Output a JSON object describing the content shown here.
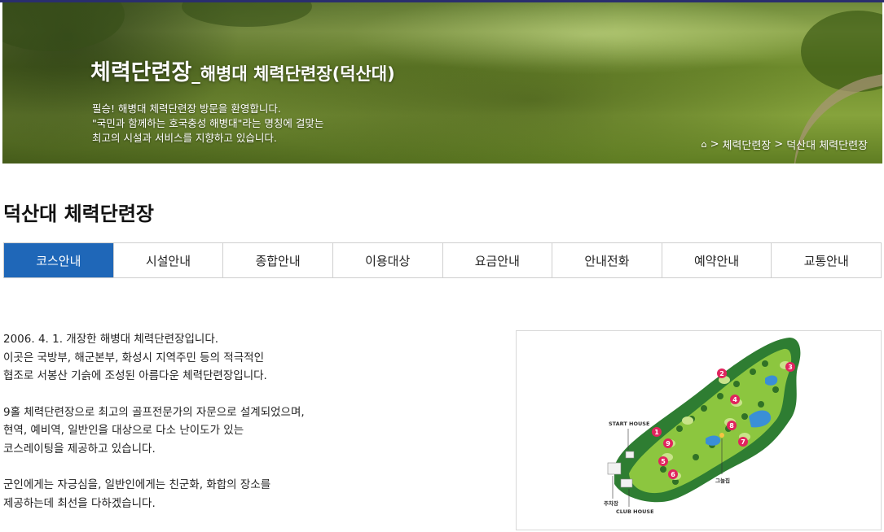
{
  "banner": {
    "title_main": "체력단련장",
    "title_sub": "_해병대 체력단련장(덕산대)",
    "desc_lines": [
      "필승! 해병대 체력단련장 방문을 환영합니다.",
      "\"국민과 함께하는 호국충성 해병대\"라는 명칭에 걸맞는",
      "최고의 시설과 서비스를 지향하고 있습니다."
    ]
  },
  "breadcrumb": {
    "icon": "home-icon",
    "items": [
      "체력단련장",
      "덕산대 체력단련장"
    ],
    "separator": ">"
  },
  "page_title": "덕산대 체력단련장",
  "tabs": [
    {
      "label": "코스안내",
      "active": true
    },
    {
      "label": "시설안내",
      "active": false
    },
    {
      "label": "종합안내",
      "active": false
    },
    {
      "label": "이용대상",
      "active": false
    },
    {
      "label": "요금안내",
      "active": false
    },
    {
      "label": "안내전화",
      "active": false
    },
    {
      "label": "예약안내",
      "active": false
    },
    {
      "label": "교통안내",
      "active": false
    }
  ],
  "content": {
    "paragraphs": [
      "2006. 4. 1. 개장한 해병대 체력단련장입니다.\n이곳은 국방부, 해군본부, 화성시 지역주민 등의 적극적인\n협조로 서봉산 기슭에 조성된 아름다운 체력단련장입니다.",
      "9홀 체력단련장으로 최고의 골프전문가의 자문으로 설계되었으며,\n현역, 예비역, 일반인을 대상으로 다소 난이도가 있는\n코스레이팅을 제공하고 있습니다.",
      "군인에게는 자긍심을, 일반인에게는 친군화, 화합의 장소를\n제공하는데 최선을 다하겠습니다."
    ]
  },
  "course_map": {
    "labels": {
      "start_house": "START HOUSE",
      "club_house": "CLUB HOUSE",
      "parking": "주차장",
      "shelter": "그늘집"
    },
    "holes": [
      "1",
      "2",
      "3",
      "4",
      "5",
      "6",
      "7",
      "8",
      "9"
    ],
    "colors": {
      "fairway": "#8cc63f",
      "green": "#c9e38a",
      "rough": "#2e7d32",
      "water": "#3a8fd6",
      "hole_marker": "#e0245e"
    }
  },
  "colors": {
    "accent": "#1f67b8",
    "topbar": "#2a2e6e"
  }
}
